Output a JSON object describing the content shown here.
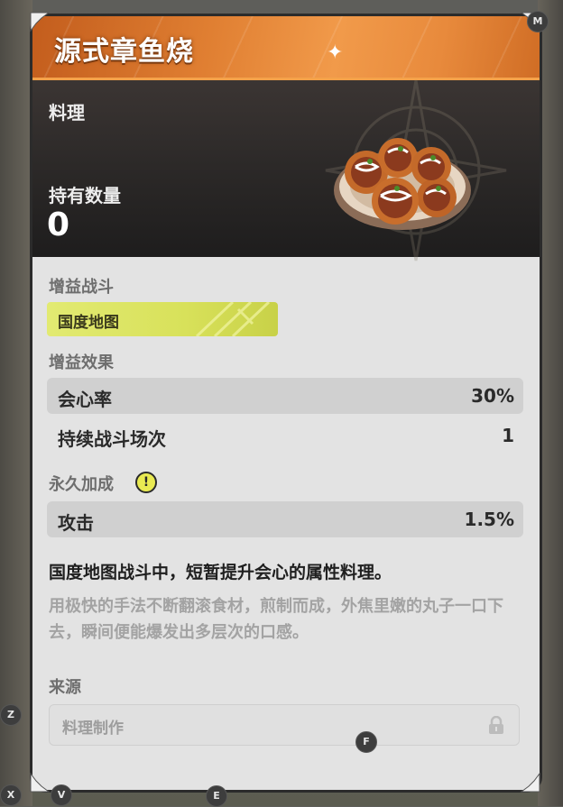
{
  "item": {
    "name": "源式章鱼烧",
    "category": "料理",
    "owned_label": "持有数量",
    "owned_count": "0"
  },
  "buff_battle": {
    "label": "增益战斗",
    "tag": "国度地图"
  },
  "buff_effect": {
    "label": "增益效果",
    "stats": [
      {
        "name": "会心率",
        "value": "30%"
      },
      {
        "name": "持续战斗场次",
        "value": "1"
      }
    ]
  },
  "permanent": {
    "label": "永久加成",
    "stats": [
      {
        "name": "攻击",
        "value": "1.5%"
      }
    ]
  },
  "description": {
    "main": "国度地图战斗中，短暂提升会心的属性料理。",
    "flavor": "用极快的手法不断翻滚食材，煎制而成，外焦里嫩的丸子一口下去，瞬间便能爆发出多层次的口感。"
  },
  "source": {
    "label": "来源",
    "entry": "料理制作"
  },
  "hints": {
    "m": "M",
    "z": "Z",
    "f": "F",
    "x": "X",
    "v": "V",
    "e": "E"
  },
  "colors": {
    "title_accent": "#e07f32",
    "buff_tag": "#dbe35f",
    "card_bg": "#e3e3e3"
  },
  "icons": [
    "corner-ornament-icon",
    "warning-icon",
    "lock-icon",
    "sparkle-icon"
  ]
}
